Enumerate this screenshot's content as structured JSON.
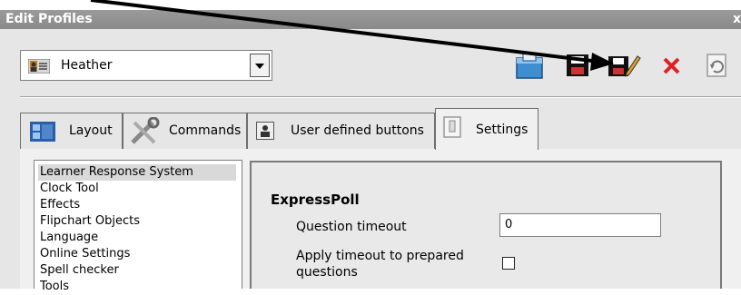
{
  "window": {
    "title": "Edit Profiles",
    "close_glyph": "x"
  },
  "profile": {
    "selected": "Heather",
    "icon": "profile-card-icon"
  },
  "toolbar": {
    "icons": [
      "new-profile-icon",
      "save-icon",
      "save-as-icon",
      "delete-icon",
      "refresh-icon"
    ]
  },
  "tabs": [
    {
      "label": "Layout",
      "icon": "layout-icon"
    },
    {
      "label": "Commands",
      "icon": "tools-icon"
    },
    {
      "label": "User defined buttons",
      "icon": "user-button-icon"
    },
    {
      "label": "Settings",
      "icon": "settings-page-icon",
      "active": true
    }
  ],
  "settings_list": {
    "items": [
      "Learner Response System",
      "Clock Tool",
      "Effects",
      "Flipchart Objects",
      "Language",
      "Online Settings",
      "Spell checker",
      "Tools"
    ],
    "selected_index": 0
  },
  "group": {
    "title": "ExpressPoll",
    "question_timeout_label": "Question timeout",
    "question_timeout_value": "0",
    "apply_timeout_label_line1": "Apply timeout to prepared",
    "apply_timeout_label_line2": "questions",
    "apply_timeout_checked": false
  },
  "colors": {
    "delete_red": "#e02020",
    "title_bar": "#8f8f8f"
  }
}
